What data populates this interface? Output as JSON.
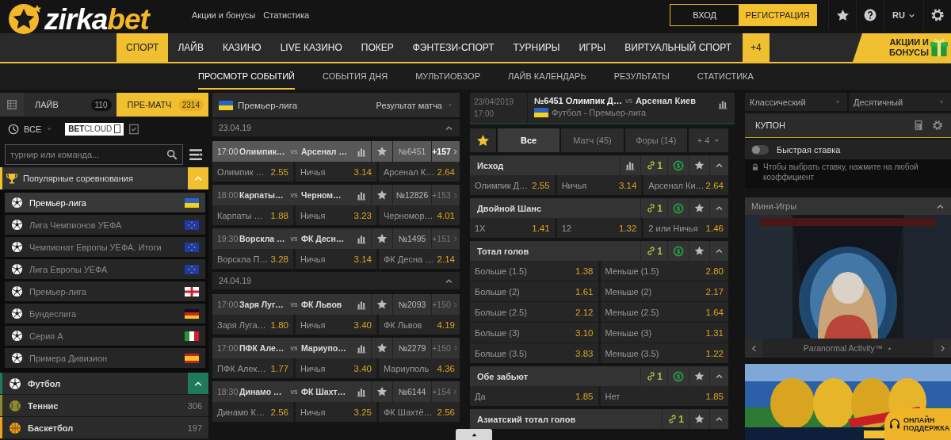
{
  "header": {
    "logo": {
      "main": "zirka",
      "accent": "bet"
    },
    "links": [
      "Акции и бонусы",
      "Статистика"
    ],
    "login": "ВХОД",
    "register": "РЕГИСТРАЦИЯ",
    "language": "RU"
  },
  "nav": {
    "items": [
      {
        "label": "СПОРТ",
        "selected": true
      },
      {
        "label": "ЛАЙВ",
        "selected": false
      },
      {
        "label": "КАЗИНО",
        "selected": false
      },
      {
        "label": "LIVE КАЗИНО",
        "selected": false
      },
      {
        "label": "ПОКЕР",
        "selected": false
      },
      {
        "label": "ФЭНТЕЗИ-СПОРТ",
        "selected": false
      },
      {
        "label": "ТУРНИРЫ",
        "selected": false
      },
      {
        "label": "ИГРЫ",
        "selected": false
      },
      {
        "label": "ВИРТУАЛЬНЫЙ СПОРТ",
        "selected": false
      }
    ],
    "more": "+4",
    "promo": "АКЦИИ И БОНУСЫ"
  },
  "subnav": [
    {
      "label": "ПРОСМОТР СОБЫТИЙ",
      "selected": true
    },
    {
      "label": "СОБЫТИЯ ДНЯ",
      "selected": false
    },
    {
      "label": "МУЛЬТИОБЗОР",
      "selected": false
    },
    {
      "label": "ЛАЙВ КАЛЕНДАРЬ",
      "selected": false
    },
    {
      "label": "РЕЗУЛЬТАТЫ",
      "selected": false
    },
    {
      "label": "СТАТИСТИКА",
      "selected": false
    }
  ],
  "sidebar": {
    "tabs": [
      {
        "label": "ЛАЙВ",
        "count": "110",
        "selected": false
      },
      {
        "label": "ПРЕ-МАТЧ",
        "count": "2314",
        "selected": true
      }
    ],
    "filter": "ВСЕ",
    "betcloud": "**BET**CLOUD",
    "search": {
      "placeholder": "турнир или команда..."
    },
    "popular": {
      "title": "Популярные соревнования",
      "expanded": true,
      "items": [
        {
          "name": "Премьер-лига",
          "kind": "ua",
          "selected": true
        },
        {
          "name": "Лига Чемпионов УЕФА",
          "kind": "eu",
          "selected": false
        },
        {
          "name": "Чемпионат Европы УЕФА. Итоги",
          "kind": "eu",
          "selected": false
        },
        {
          "name": "Лига Европы УЕФА",
          "kind": "eu",
          "selected": false
        },
        {
          "name": "Премьер-лига",
          "kind": "en",
          "selected": false
        },
        {
          "name": "Бундеслига",
          "kind": "de",
          "selected": false
        },
        {
          "name": "Серия А",
          "kind": "it",
          "selected": false
        },
        {
          "name": "Примера Дивизион",
          "kind": "es",
          "selected": false
        }
      ]
    },
    "sports": [
      {
        "name": "Футбол",
        "kind": "football",
        "color": "#1e7a5a",
        "expanded": true
      },
      {
        "name": "Теннис",
        "kind": "tennis",
        "color": "#8c8a2e",
        "count": "306",
        "expanded": false
      },
      {
        "name": "Баскетбол",
        "kind": "basketball",
        "color": "#f0a020",
        "count": "197",
        "expanded": false
      }
    ]
  },
  "events": {
    "league": {
      "kind": "ua",
      "name": "Премьер-лига",
      "market": "Результат матча"
    },
    "days": [
      {
        "date": "23.04.19",
        "expanded": true,
        "matches": [
          {
            "time": "17:00",
            "home": "Олимпик…",
            "versus": "vs",
            "away": "Арсенал …",
            "number": "№6451",
            "more": "+157",
            "selected": true,
            "odds": [
              {
                "label": "Олимпик …",
                "value": "2.55"
              },
              {
                "label": "Ничья",
                "value": "3.14"
              },
              {
                "label": "Арсенал К…",
                "value": "2.64"
              }
            ]
          },
          {
            "time": "18:00",
            "home": "Карпаты…",
            "versus": "vs",
            "away": "Черном…",
            "number": "№12826",
            "more": "+153",
            "selected": false,
            "odds": [
              {
                "label": "Карпаты …",
                "value": "1.88"
              },
              {
                "label": "Ничья",
                "value": "3.23"
              },
              {
                "label": "Черномор…",
                "value": "4.01"
              }
            ]
          },
          {
            "time": "19:30",
            "home": "Ворскла …",
            "versus": "vs",
            "away": "ФК Десн…",
            "number": "№1495",
            "more": "+151",
            "selected": false,
            "odds": [
              {
                "label": "Ворскла П…",
                "value": "3.28"
              },
              {
                "label": "Ничья",
                "value": "3.14"
              },
              {
                "label": "ФК Десна …",
                "value": "2.14"
              }
            ]
          }
        ]
      },
      {
        "date": "24.04.19",
        "expanded": true,
        "matches": [
          {
            "time": "17:00",
            "home": "Заря Луг…",
            "versus": "vs",
            "away": "ФК Львов",
            "number": "№2093",
            "more": "+150",
            "selected": false,
            "odds": [
              {
                "label": "Заря Луга…",
                "value": "1.80"
              },
              {
                "label": "Ничья",
                "value": "3.40"
              },
              {
                "label": "ФК Львов",
                "value": "4.19"
              }
            ]
          },
          {
            "time": "17:00",
            "home": "ПФК Але…",
            "versus": "vs",
            "away": "Мариупо…",
            "number": "№2279",
            "more": "+150",
            "selected": false,
            "odds": [
              {
                "label": "ПФК Алек…",
                "value": "1.77"
              },
              {
                "label": "Ничья",
                "value": "3.40"
              },
              {
                "label": "Мариуполь",
                "value": "4.36"
              }
            ]
          },
          {
            "time": "18:30",
            "home": "Динамо …",
            "versus": "vs",
            "away": "ФК Шахт…",
            "number": "№6144",
            "more": "+154",
            "selected": false,
            "odds": [
              {
                "label": "Динамо К…",
                "value": "2.56"
              },
              {
                "label": "Ничья",
                "value": "3.25"
              },
              {
                "label": "ФК Шахтё…",
                "value": "2.56"
              }
            ]
          }
        ]
      }
    ]
  },
  "match": {
    "date": "23/04/2019",
    "time": "17:00",
    "number": "№6451",
    "home": "Олимпик Д…",
    "versus": "vs",
    "away": "Арсенал Киев",
    "kind": "ua",
    "league": "Футбол - Премьер-лига",
    "tabs": [
      {
        "label": "Все",
        "selected": true
      },
      {
        "label": "Матч (45)",
        "selected": false
      },
      {
        "label": "Форы (14)",
        "selected": false
      },
      {
        "label": "+ 4",
        "selected": false
      }
    ],
    "markets": [
      {
        "title": "Исход",
        "stats": true,
        "links": "1",
        "cashout": true,
        "expanded": true,
        "rows": [
          [
            {
              "label": "Олимпик Д…",
              "value": "2.55"
            },
            {
              "label": "Ничья",
              "value": "3.14"
            },
            {
              "label": "Арсенал Ки…",
              "value": "2.64"
            }
          ]
        ]
      },
      {
        "title": "Двойной Шанс",
        "stats": false,
        "links": "1",
        "cashout": true,
        "expanded": true,
        "rows": [
          [
            {
              "label": "1X",
              "value": "1.41"
            },
            {
              "label": "12",
              "value": "1.32"
            },
            {
              "label": "2 или Ничья",
              "value": "1.46"
            }
          ]
        ]
      },
      {
        "title": "Тотал голов",
        "stats": false,
        "links": "1",
        "cashout": true,
        "expanded": true,
        "rows": [
          [
            {
              "label": "Больше (1.5)",
              "value": "1.38"
            },
            {
              "label": "Меньше (1.5)",
              "value": "2.80"
            }
          ],
          [
            {
              "label": "Больше (2)",
              "value": "1.61"
            },
            {
              "label": "Меньше (2)",
              "value": "2.17"
            }
          ],
          [
            {
              "label": "Больше (2.5)",
              "value": "2.12"
            },
            {
              "label": "Меньше (2.5)",
              "value": "1.64"
            }
          ],
          [
            {
              "label": "Больше (3)",
              "value": "3.10"
            },
            {
              "label": "Меньше (3)",
              "value": "1.31"
            }
          ],
          [
            {
              "label": "Больше (3.5)",
              "value": "3.83"
            },
            {
              "label": "Меньше (3.5)",
              "value": "1.22"
            }
          ]
        ]
      },
      {
        "title": "Обе забьют",
        "stats": false,
        "links": "1",
        "cashout": true,
        "expanded": true,
        "rows": [
          [
            {
              "label": "Да",
              "value": "1.85"
            },
            {
              "label": "Нет",
              "value": "1.85"
            }
          ]
        ]
      },
      {
        "title": "Азиатский тотал голов",
        "stats": false,
        "links": "1",
        "cashout": false,
        "expanded": true
      }
    ]
  },
  "coupon": {
    "formats": [
      "Классический",
      "Десятичный"
    ],
    "title": "КУПОН",
    "quick_bet": {
      "label": "Быстрая ставка",
      "on": false
    },
    "hint": "Чтобы выбрать ставку, нажмите на любой коэффициент"
  },
  "games": {
    "title": "Мини-Игры",
    "expanded": true,
    "game": "Paranormal Activity™"
  },
  "support": "ОНЛАЙН ПОДДЕРЖКА"
}
